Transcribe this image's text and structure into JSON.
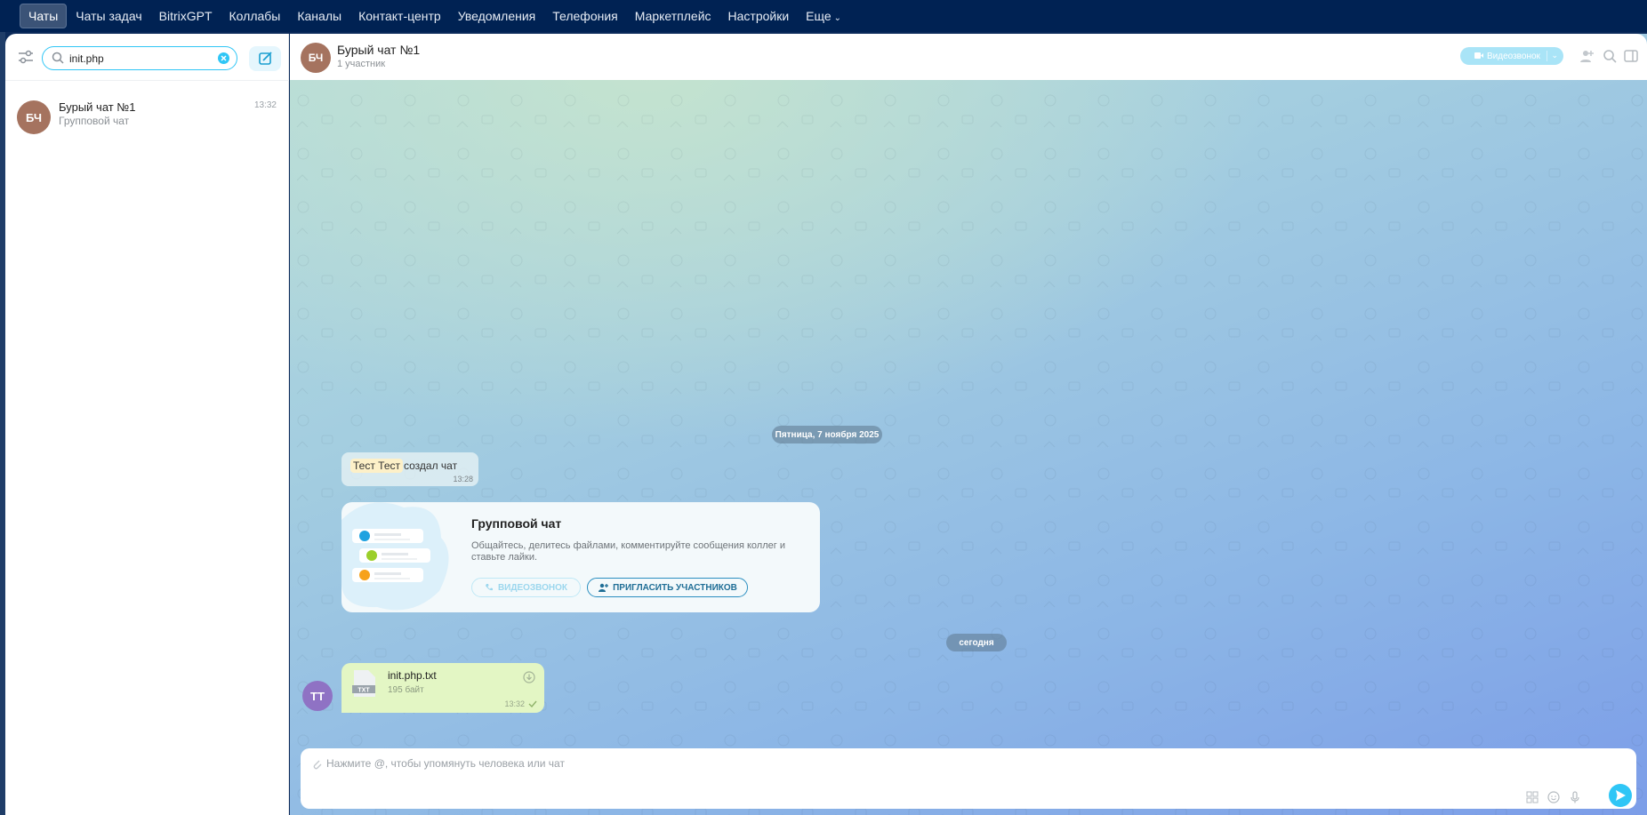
{
  "topnav": {
    "items": [
      "Чаты",
      "Чаты задач",
      "BitrixGPT",
      "Коллабы",
      "Каналы",
      "Контакт-центр",
      "Уведомления",
      "Телефония",
      "Маркетплейс",
      "Настройки",
      "Еще"
    ],
    "active_index": 0
  },
  "sidebar": {
    "search_value": "init.php",
    "chats": [
      {
        "initials": "БЧ",
        "title": "Бурый чат №1",
        "subtitle": "Групповой чат",
        "time": "13:32",
        "avatar_color": "#a5735f"
      }
    ]
  },
  "chat": {
    "header": {
      "initials": "БЧ",
      "title": "Бурый чат №1",
      "subtitle": "1 участник",
      "video_label": "Видеозвонок"
    },
    "date_separator_1": "Пятница, 7 ноября 2025",
    "system_message": {
      "name": "Тест Тест",
      "text": "создал чат",
      "time": "13:28"
    },
    "intro_card": {
      "title": "Групповой чат",
      "description": "Общайтесь, делитесь файлами, комментируйте сообщения коллег и ставьте лайки.",
      "video_button": "ВИДЕОЗВОНОК",
      "invite_button": "ПРИГЛАСИТЬ УЧАСТНИКОВ"
    },
    "date_separator_2": "сегодня",
    "file_message": {
      "author_initials": "ТТ",
      "file_badge": "TXT",
      "file_name": "init.php.txt",
      "file_size": "195 байт",
      "time": "13:32"
    },
    "composer": {
      "placeholder": "Нажмите @, чтобы упомянуть человека или чат"
    }
  },
  "colors": {
    "accent": "#2fc6f6",
    "nav_bg": "#002253",
    "avatar_bch": "#a5735f",
    "avatar_tt": "#8f72c4",
    "file_bubble": "#e3f6c4"
  }
}
